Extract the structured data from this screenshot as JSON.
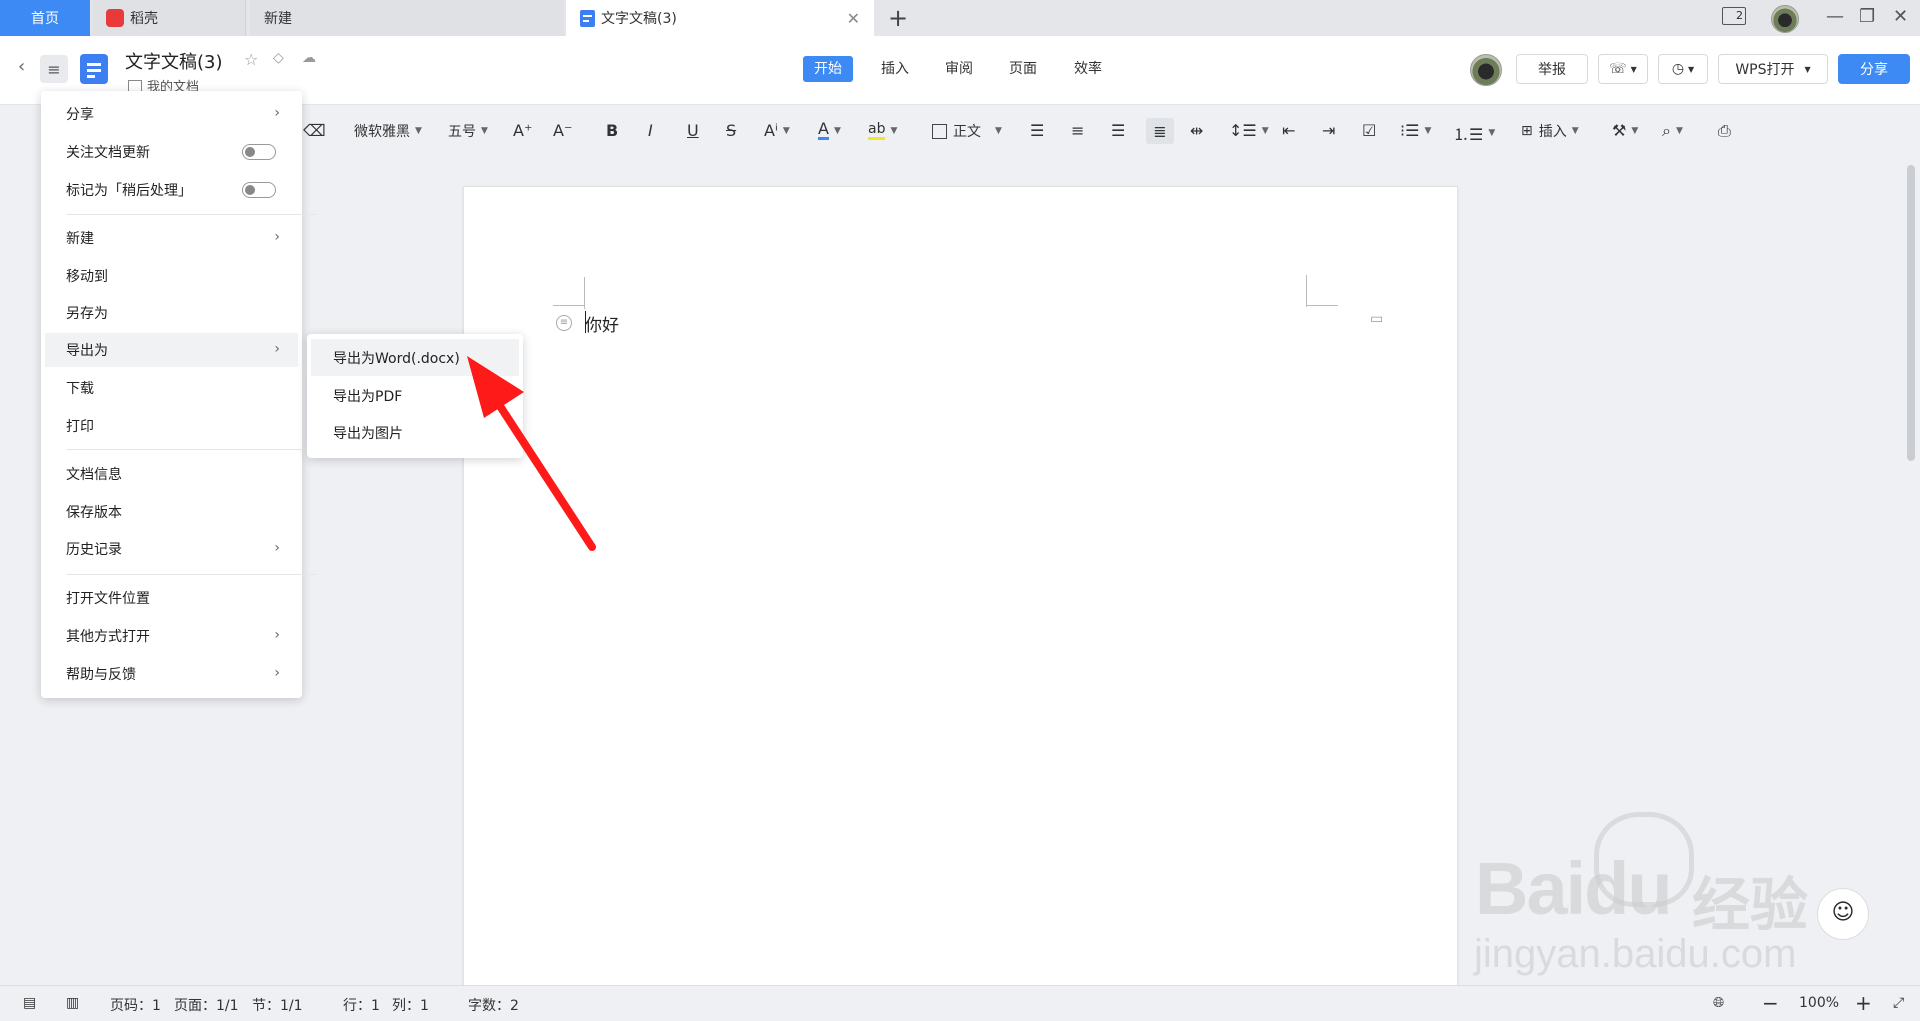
{
  "tabs": {
    "home": "首页",
    "daoke": "稻壳",
    "new": "新建",
    "doc": "文字文稿(3)"
  },
  "window": {
    "badge": "2"
  },
  "header": {
    "title": "文字文稿(3)",
    "folder": "我的文档",
    "nav": [
      "开始",
      "插入",
      "审阅",
      "页面",
      "效率"
    ],
    "report": "举报",
    "wps_open": "WPS打开",
    "share": "分享"
  },
  "toolbar": {
    "font": "微软雅黑",
    "size": "五号",
    "style": "正文",
    "insert": "插入"
  },
  "document": {
    "text": "你好"
  },
  "menu": {
    "share": "分享",
    "follow": "关注文档更新",
    "mark_later": "标记为「稍后处理」",
    "new": "新建",
    "move_to": "移动到",
    "save_as": "另存为",
    "export_as": "导出为",
    "download": "下载",
    "print": "打印",
    "doc_info": "文档信息",
    "save_version": "保存版本",
    "history": "历史记录",
    "open_location": "打开文件位置",
    "open_other": "其他方式打开",
    "help": "帮助与反馈"
  },
  "submenu": {
    "word": "导出为Word(.docx)",
    "pdf": "导出为PDF",
    "image": "导出为图片"
  },
  "status": {
    "page_no": "页码：1",
    "page": "页面：1/1",
    "section": "节：1/1",
    "row": "行：1",
    "col": "列：1",
    "words": "字数：2",
    "zoom": "100%"
  },
  "watermark": {
    "brand": "Baidu",
    "cn": "经验",
    "url": "jingyan.baidu.com"
  },
  "colors": {
    "accent": "#3d8af5",
    "arrow": "#ff1a1a"
  }
}
